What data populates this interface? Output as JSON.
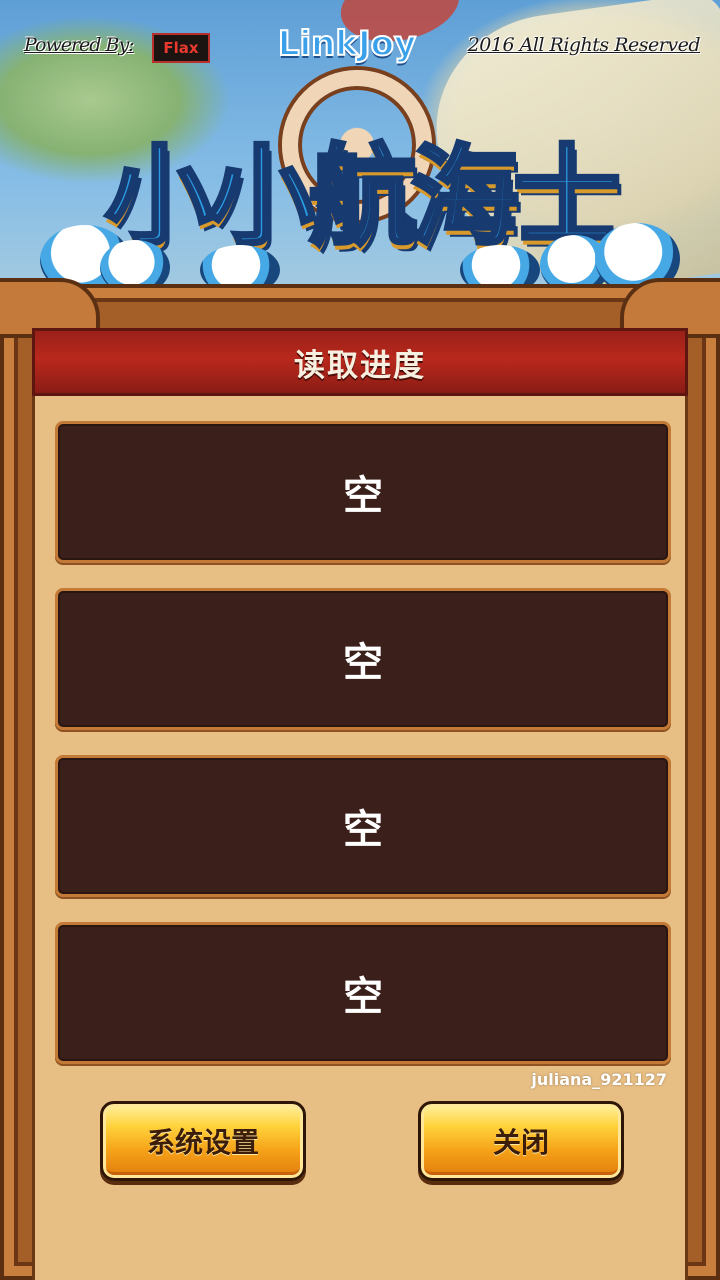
{
  "header": {
    "powered_by": "Powered By:",
    "powered_by_brand": "Flax",
    "publisher": "LinkJoy",
    "rights": "2016 All Rights Reserved",
    "game_title": "小小航海士"
  },
  "dialog": {
    "title": "读取进度",
    "slots": [
      {
        "label": "空"
      },
      {
        "label": "空"
      },
      {
        "label": "空"
      },
      {
        "label": "空"
      }
    ],
    "username": "juliana_921127",
    "buttons": {
      "settings": "系统设置",
      "close": "关闭"
    }
  },
  "colors": {
    "panel_wood": "#a45f28",
    "panel_inner": "#e7be84",
    "title_bar_red": "#b9281c",
    "slot_bg": "#3b1f1a",
    "button_gold": "#f6a319",
    "logo_blue": "#2a9ce4"
  }
}
